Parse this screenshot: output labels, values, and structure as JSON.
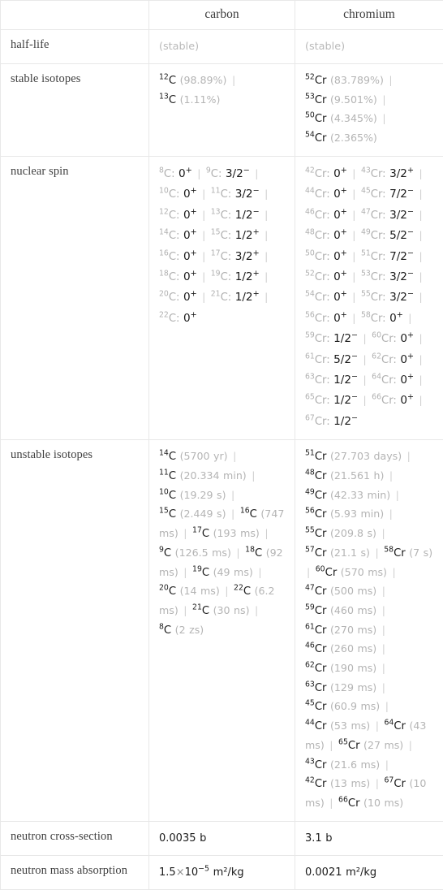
{
  "table": {
    "header": {
      "corner": "",
      "columns": [
        "carbon",
        "chromium"
      ]
    },
    "rows": [
      {
        "label": "half-life",
        "carbon": "(stable)",
        "chromium": "(stable)"
      },
      {
        "label": "stable isotopes",
        "carbon_items": [
          {
            "mass": "12",
            "sym": "C",
            "note": "(98.89%)"
          },
          {
            "mass": "13",
            "sym": "C",
            "note": "(1.11%)"
          }
        ],
        "chromium_items": [
          {
            "mass": "52",
            "sym": "Cr",
            "note": "(83.789%)"
          },
          {
            "mass": "53",
            "sym": "Cr",
            "note": "(9.501%)"
          },
          {
            "mass": "50",
            "sym": "Cr",
            "note": "(4.345%)"
          },
          {
            "mass": "54",
            "sym": "Cr",
            "note": "(2.365%)"
          }
        ]
      },
      {
        "label": "nuclear spin",
        "carbon_spins": [
          {
            "mass": "8",
            "sym": "C",
            "spin": "0",
            "par": "+"
          },
          {
            "mass": "9",
            "sym": "C",
            "spin": "3/2",
            "par": "-"
          },
          {
            "mass": "10",
            "sym": "C",
            "spin": "0",
            "par": "+"
          },
          {
            "mass": "11",
            "sym": "C",
            "spin": "3/2",
            "par": "-"
          },
          {
            "mass": "12",
            "sym": "C",
            "spin": "0",
            "par": "+"
          },
          {
            "mass": "13",
            "sym": "C",
            "spin": "1/2",
            "par": "-"
          },
          {
            "mass": "14",
            "sym": "C",
            "spin": "0",
            "par": "+"
          },
          {
            "mass": "15",
            "sym": "C",
            "spin": "1/2",
            "par": "+"
          },
          {
            "mass": "16",
            "sym": "C",
            "spin": "0",
            "par": "+"
          },
          {
            "mass": "17",
            "sym": "C",
            "spin": "3/2",
            "par": "+"
          },
          {
            "mass": "18",
            "sym": "C",
            "spin": "0",
            "par": "+"
          },
          {
            "mass": "19",
            "sym": "C",
            "spin": "1/2",
            "par": "+"
          },
          {
            "mass": "20",
            "sym": "C",
            "spin": "0",
            "par": "+"
          },
          {
            "mass": "21",
            "sym": "C",
            "spin": "1/2",
            "par": "+"
          },
          {
            "mass": "22",
            "sym": "C",
            "spin": "0",
            "par": "+"
          }
        ],
        "chromium_spins": [
          {
            "mass": "42",
            "sym": "Cr",
            "spin": "0",
            "par": "+"
          },
          {
            "mass": "43",
            "sym": "Cr",
            "spin": "3/2",
            "par": "+"
          },
          {
            "mass": "44",
            "sym": "Cr",
            "spin": "0",
            "par": "+"
          },
          {
            "mass": "45",
            "sym": "Cr",
            "spin": "7/2",
            "par": "-"
          },
          {
            "mass": "46",
            "sym": "Cr",
            "spin": "0",
            "par": "+"
          },
          {
            "mass": "47",
            "sym": "Cr",
            "spin": "3/2",
            "par": "-"
          },
          {
            "mass": "48",
            "sym": "Cr",
            "spin": "0",
            "par": "+"
          },
          {
            "mass": "49",
            "sym": "Cr",
            "spin": "5/2",
            "par": "-"
          },
          {
            "mass": "50",
            "sym": "Cr",
            "spin": "0",
            "par": "+"
          },
          {
            "mass": "51",
            "sym": "Cr",
            "spin": "7/2",
            "par": "-"
          },
          {
            "mass": "52",
            "sym": "Cr",
            "spin": "0",
            "par": "+"
          },
          {
            "mass": "53",
            "sym": "Cr",
            "spin": "3/2",
            "par": "-"
          },
          {
            "mass": "54",
            "sym": "Cr",
            "spin": "0",
            "par": "+"
          },
          {
            "mass": "55",
            "sym": "Cr",
            "spin": "3/2",
            "par": "-"
          },
          {
            "mass": "56",
            "sym": "Cr",
            "spin": "0",
            "par": "+"
          },
          {
            "mass": "58",
            "sym": "Cr",
            "spin": "0",
            "par": "+"
          },
          {
            "mass": "59",
            "sym": "Cr",
            "spin": "1/2",
            "par": "-"
          },
          {
            "mass": "60",
            "sym": "Cr",
            "spin": "0",
            "par": "+"
          },
          {
            "mass": "61",
            "sym": "Cr",
            "spin": "5/2",
            "par": "-"
          },
          {
            "mass": "62",
            "sym": "Cr",
            "spin": "0",
            "par": "+"
          },
          {
            "mass": "63",
            "sym": "Cr",
            "spin": "1/2",
            "par": "-"
          },
          {
            "mass": "64",
            "sym": "Cr",
            "spin": "0",
            "par": "+"
          },
          {
            "mass": "65",
            "sym": "Cr",
            "spin": "1/2",
            "par": "-"
          },
          {
            "mass": "66",
            "sym": "Cr",
            "spin": "0",
            "par": "+"
          },
          {
            "mass": "67",
            "sym": "Cr",
            "spin": "1/2",
            "par": "-"
          }
        ]
      },
      {
        "label": "unstable isotopes",
        "carbon_unstable": [
          {
            "mass": "14",
            "sym": "C",
            "note": "(5700 yr)"
          },
          {
            "mass": "11",
            "sym": "C",
            "note": "(20.334 min)"
          },
          {
            "mass": "10",
            "sym": "C",
            "note": "(19.29 s)"
          },
          {
            "mass": "15",
            "sym": "C",
            "note": "(2.449 s)"
          },
          {
            "mass": "16",
            "sym": "C",
            "note": "(747 ms)"
          },
          {
            "mass": "17",
            "sym": "C",
            "note": "(193 ms)"
          },
          {
            "mass": "9",
            "sym": "C",
            "note": "(126.5 ms)"
          },
          {
            "mass": "18",
            "sym": "C",
            "note": "(92 ms)"
          },
          {
            "mass": "19",
            "sym": "C",
            "note": "(49 ms)"
          },
          {
            "mass": "20",
            "sym": "C",
            "note": "(14 ms)"
          },
          {
            "mass": "22",
            "sym": "C",
            "note": "(6.2 ms)"
          },
          {
            "mass": "21",
            "sym": "C",
            "note": "(30 ns)"
          },
          {
            "mass": "8",
            "sym": "C",
            "note": "(2 zs)"
          }
        ],
        "chromium_unstable": [
          {
            "mass": "51",
            "sym": "Cr",
            "note": "(27.703 days)"
          },
          {
            "mass": "48",
            "sym": "Cr",
            "note": "(21.561 h)"
          },
          {
            "mass": "49",
            "sym": "Cr",
            "note": "(42.33 min)"
          },
          {
            "mass": "56",
            "sym": "Cr",
            "note": "(5.93 min)"
          },
          {
            "mass": "55",
            "sym": "Cr",
            "note": "(209.8 s)"
          },
          {
            "mass": "57",
            "sym": "Cr",
            "note": "(21.1 s)"
          },
          {
            "mass": "58",
            "sym": "Cr",
            "note": "(7 s)"
          },
          {
            "mass": "60",
            "sym": "Cr",
            "note": "(570 ms)"
          },
          {
            "mass": "47",
            "sym": "Cr",
            "note": "(500 ms)"
          },
          {
            "mass": "59",
            "sym": "Cr",
            "note": "(460 ms)"
          },
          {
            "mass": "61",
            "sym": "Cr",
            "note": "(270 ms)"
          },
          {
            "mass": "46",
            "sym": "Cr",
            "note": "(260 ms)"
          },
          {
            "mass": "62",
            "sym": "Cr",
            "note": "(190 ms)"
          },
          {
            "mass": "63",
            "sym": "Cr",
            "note": "(129 ms)"
          },
          {
            "mass": "45",
            "sym": "Cr",
            "note": "(60.9 ms)"
          },
          {
            "mass": "44",
            "sym": "Cr",
            "note": "(53 ms)"
          },
          {
            "mass": "64",
            "sym": "Cr",
            "note": "(43 ms)"
          },
          {
            "mass": "65",
            "sym": "Cr",
            "note": "(27 ms)"
          },
          {
            "mass": "43",
            "sym": "Cr",
            "note": "(21.6 ms)"
          },
          {
            "mass": "42",
            "sym": "Cr",
            "note": "(13 ms)"
          },
          {
            "mass": "67",
            "sym": "Cr",
            "note": "(10 ms)"
          },
          {
            "mass": "66",
            "sym": "Cr",
            "note": "(10 ms)"
          }
        ]
      },
      {
        "label": "neutron cross-section",
        "carbon": "0.0035 b",
        "chromium": "3.1 b"
      },
      {
        "label": "neutron mass absorption",
        "carbon_sci": {
          "mantissa": "1.5",
          "times": "×",
          "base": "10",
          "exp": "-5",
          "unit": "m²/kg"
        },
        "chromium": "0.0021 m²/kg"
      }
    ]
  }
}
